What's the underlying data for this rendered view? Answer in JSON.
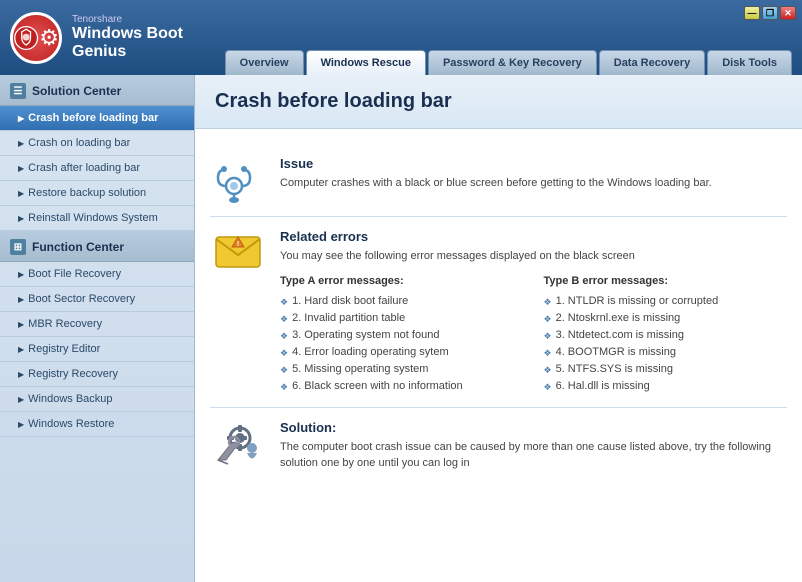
{
  "app": {
    "company": "Tenorshare",
    "product": "Windows Boot Genius"
  },
  "nav": {
    "tabs": [
      {
        "id": "overview",
        "label": "Overview",
        "active": false
      },
      {
        "id": "windows-rescue",
        "label": "Windows Rescue",
        "active": true
      },
      {
        "id": "password-key-recovery",
        "label": "Password & Key Recovery",
        "active": false
      },
      {
        "id": "data-recovery",
        "label": "Data Recovery",
        "active": false
      },
      {
        "id": "disk-tools",
        "label": "Disk Tools",
        "active": false
      }
    ]
  },
  "sidebar": {
    "solution_center": {
      "title": "Solution Center",
      "items": [
        {
          "id": "crash-before",
          "label": "Crash before loading bar",
          "active": true
        },
        {
          "id": "crash-on",
          "label": "Crash on loading bar",
          "active": false
        },
        {
          "id": "crash-after",
          "label": "Crash after loading bar",
          "active": false
        },
        {
          "id": "restore-backup",
          "label": "Restore backup solution",
          "active": false
        },
        {
          "id": "reinstall-windows",
          "label": "Reinstall Windows System",
          "active": false
        }
      ]
    },
    "function_center": {
      "title": "Function Center",
      "items": [
        {
          "id": "boot-file",
          "label": "Boot File Recovery",
          "active": false
        },
        {
          "id": "boot-sector",
          "label": "Boot Sector Recovery",
          "active": false
        },
        {
          "id": "mbr-recovery",
          "label": "MBR Recovery",
          "active": false
        },
        {
          "id": "registry-editor",
          "label": "Registry Editor",
          "active": false
        },
        {
          "id": "registry-recovery",
          "label": "Registry Recovery",
          "active": false
        },
        {
          "id": "windows-backup",
          "label": "Windows Backup",
          "active": false
        },
        {
          "id": "windows-restore",
          "label": "Windows Restore",
          "active": false
        }
      ]
    }
  },
  "content": {
    "page_title": "Crash before loading bar",
    "issue": {
      "title": "Issue",
      "text": "Computer crashes with a black or blue screen before getting to the Windows loading bar."
    },
    "related_errors": {
      "title": "Related errors",
      "subtitle": "You may see the following error messages displayed on the black screen",
      "type_a_label": "Type A error messages:",
      "type_a_items": [
        "1. Hard disk boot failure",
        "2. Invalid partition table",
        "3. Operating system not found",
        "4. Error loading operating sytem",
        "5. Missing operating system",
        "6. Black screen with no information"
      ],
      "type_b_label": "Type B error messages:",
      "type_b_items": [
        "1. NTLDR is missing or corrupted",
        "2. Ntoskrnl.exe is missing",
        "3. Ntdetect.com is missing",
        "4. BOOTMGR is missing",
        "5. NTFS.SYS is missing",
        "6. Hal.dll is missing"
      ]
    },
    "solution": {
      "title": "Solution:",
      "text": "The computer boot crash issue can be caused by more than one cause listed above, try the following solution one by one until you can log in"
    }
  }
}
